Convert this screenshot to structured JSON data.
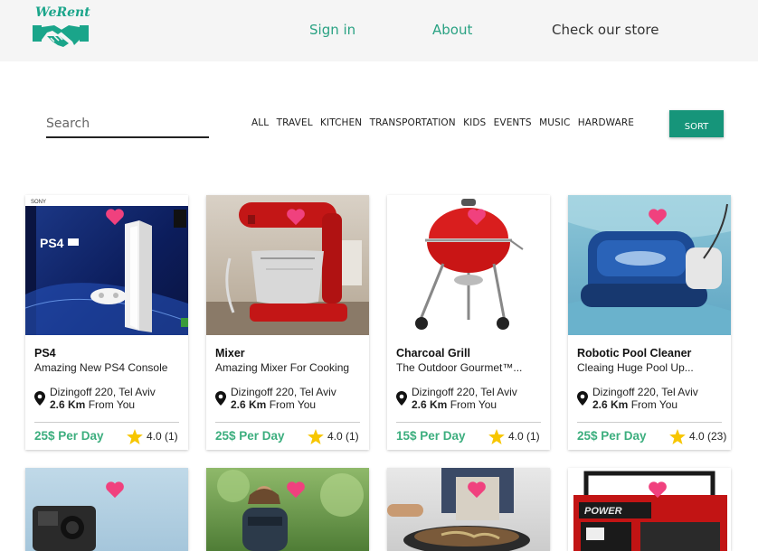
{
  "brand": {
    "logo_text": "WeRent"
  },
  "nav": {
    "signin": "Sign in",
    "about": "About",
    "store": "Check our store"
  },
  "search": {
    "placeholder": "Search"
  },
  "categories": [
    "ALL",
    "TRAVEL",
    "KITCHEN",
    "TRANSPORTATION",
    "KIDS",
    "EVENTS",
    "MUSIC",
    "HARDWARE"
  ],
  "sort_label": "SORT",
  "colors": {
    "accent": "#16957a",
    "link": "#2aa283",
    "price": "#3cae7e",
    "heart": "#f0417e",
    "star": "#f7c600"
  },
  "products": [
    {
      "title": "PS4",
      "subtitle": "Amazing New PS4 Console",
      "address": "Dizingoff 220, Tel Aviv",
      "distance": "2.6 Km",
      "distance_suffix": "From You",
      "price": "25$ Per Day",
      "rating": "4.0 (1)",
      "image": "ps4-console"
    },
    {
      "title": "Mixer",
      "subtitle": "Amazing Mixer For Cooking",
      "address": "Dizingoff 220, Tel Aviv",
      "distance": "2.6 Km",
      "distance_suffix": "From You",
      "price": "25$ Per Day",
      "rating": "4.0 (1)",
      "image": "stand-mixer"
    },
    {
      "title": "Charcoal Grill",
      "subtitle": "The Outdoor Gourmet™...",
      "address": "Dizingoff 220, Tel Aviv",
      "distance": "2.6 Km",
      "distance_suffix": "From You",
      "price": "15$ Per Day",
      "rating": "4.0 (1)",
      "image": "charcoal-grill"
    },
    {
      "title": "Robotic Pool Cleaner",
      "subtitle": "Cleaing Huge Pool Up...",
      "address": "Dizingoff 220, Tel Aviv",
      "distance": "2.6 Km",
      "distance_suffix": "From You",
      "price": "25$ Per Day",
      "rating": "4.0 (23)",
      "image": "pool-cleaner"
    },
    {
      "image": "action-camera"
    },
    {
      "image": "hiker-backpack"
    },
    {
      "image": "cooking-wok"
    },
    {
      "image": "power-generator"
    }
  ]
}
